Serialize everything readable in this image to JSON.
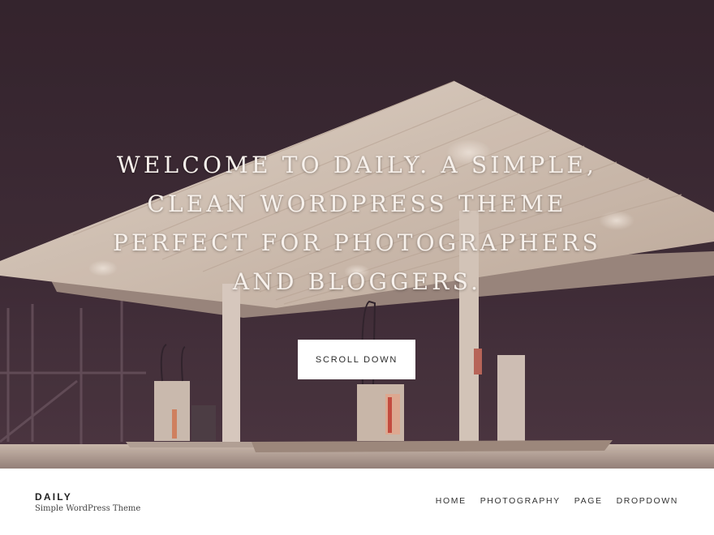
{
  "hero": {
    "headline": "Welcome to Daily. A simple, clean WordPress theme perfect for photographers and bloggers.",
    "cta_label": "Scroll Down"
  },
  "site": {
    "title": "DAILY",
    "tagline": "Simple WordPress Theme"
  },
  "nav": {
    "items": [
      {
        "label": "HOME"
      },
      {
        "label": "PHOTOGRAPHY"
      },
      {
        "label": "PAGE"
      },
      {
        "label": "DROPDOWN"
      }
    ]
  },
  "colors": {
    "night_sky": "#3a2b35",
    "canopy": "#e9dccb",
    "footer_bg": "#ffffff",
    "text_dark": "#222222"
  }
}
